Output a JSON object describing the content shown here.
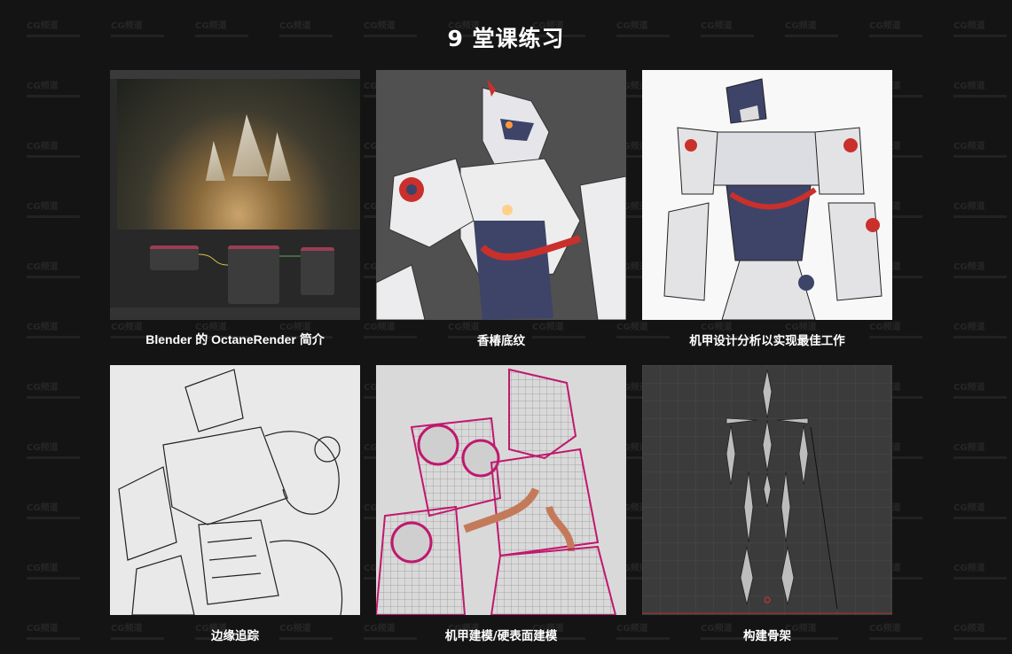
{
  "page": {
    "title": "9 堂课练习"
  },
  "watermark": {
    "logo_text": "CG频道"
  },
  "cards": [
    {
      "caption": "Blender 的 OctaneRender 简介"
    },
    {
      "caption": "香椿底纹"
    },
    {
      "caption": "机甲设计分析以实现最佳工作"
    },
    {
      "caption": "边缘追踪"
    },
    {
      "caption": "机甲建模/硬表面建模"
    },
    {
      "caption": "构建骨架"
    }
  ],
  "colors": {
    "background": "#141414",
    "text": "#ffffff",
    "accent_red": "#c9302c",
    "navy": "#3d4468",
    "magenta": "#c0186e"
  }
}
